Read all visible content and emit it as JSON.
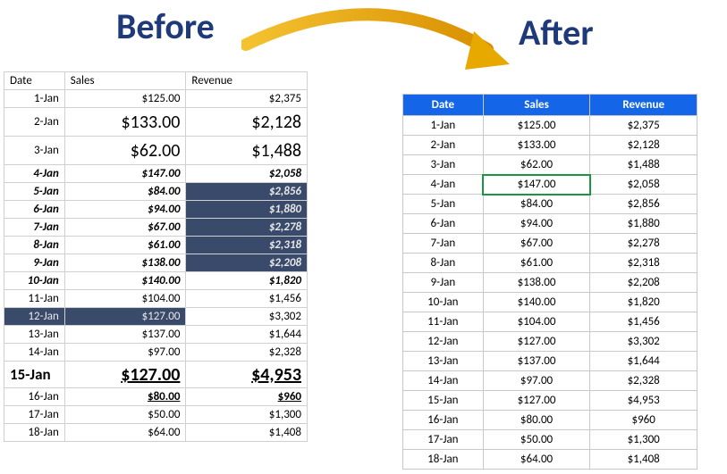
{
  "headings": {
    "before": "Before",
    "after": "After"
  },
  "columns": {
    "date": "Date",
    "sales": "Sales",
    "revenue": "Revenue"
  },
  "before_rows": [
    {
      "date": "1-Jan",
      "sales": "$125.00",
      "revenue": "$2,375"
    },
    {
      "date": "2-Jan",
      "sales": "$133.00",
      "revenue": "$2,128"
    },
    {
      "date": "3-Jan",
      "sales": "$62.00",
      "revenue": "$1,488"
    },
    {
      "date": "4-Jan",
      "sales": "$147.00",
      "revenue": "$2,058"
    },
    {
      "date": "5-Jan",
      "sales": "$84.00",
      "revenue": "$2,856"
    },
    {
      "date": "6-Jan",
      "sales": "$94.00",
      "revenue": "$1,880"
    },
    {
      "date": "7-Jan",
      "sales": "$67.00",
      "revenue": "$2,278"
    },
    {
      "date": "8-Jan",
      "sales": "$61.00",
      "revenue": "$2,318"
    },
    {
      "date": "9-Jan",
      "sales": "$138.00",
      "revenue": "$2,208"
    },
    {
      "date": "10-Jan",
      "sales": "$140.00",
      "revenue": "$1,820"
    },
    {
      "date": "11-Jan",
      "sales": "$104.00",
      "revenue": "$1,456"
    },
    {
      "date": "12-Jan",
      "sales": "$127.00",
      "revenue": "$3,302"
    },
    {
      "date": "13-Jan",
      "sales": "$137.00",
      "revenue": "$1,644"
    },
    {
      "date": "14-Jan",
      "sales": "$97.00",
      "revenue": "$2,328"
    },
    {
      "date": "15-Jan",
      "sales": "$127.00",
      "revenue": "$4,953"
    },
    {
      "date": "16-Jan",
      "sales": "$80.00",
      "revenue": "$960"
    },
    {
      "date": "17-Jan",
      "sales": "$50.00",
      "revenue": "$1,300"
    },
    {
      "date": "18-Jan",
      "sales": "$64.00",
      "revenue": "$1,408"
    }
  ],
  "after_rows": [
    {
      "date": "1-Jan",
      "sales": "$125.00",
      "revenue": "$2,375"
    },
    {
      "date": "2-Jan",
      "sales": "$133.00",
      "revenue": "$2,128"
    },
    {
      "date": "3-Jan",
      "sales": "$62.00",
      "revenue": "$1,488"
    },
    {
      "date": "4-Jan",
      "sales": "$147.00",
      "revenue": "$2,058"
    },
    {
      "date": "5-Jan",
      "sales": "$84.00",
      "revenue": "$2,856"
    },
    {
      "date": "6-Jan",
      "sales": "$94.00",
      "revenue": "$1,880"
    },
    {
      "date": "7-Jan",
      "sales": "$67.00",
      "revenue": "$2,278"
    },
    {
      "date": "8-Jan",
      "sales": "$61.00",
      "revenue": "$2,318"
    },
    {
      "date": "9-Jan",
      "sales": "$138.00",
      "revenue": "$2,208"
    },
    {
      "date": "10-Jan",
      "sales": "$140.00",
      "revenue": "$1,820"
    },
    {
      "date": "11-Jan",
      "sales": "$104.00",
      "revenue": "$1,456"
    },
    {
      "date": "12-Jan",
      "sales": "$127.00",
      "revenue": "$3,302"
    },
    {
      "date": "13-Jan",
      "sales": "$137.00",
      "revenue": "$1,644"
    },
    {
      "date": "14-Jan",
      "sales": "$97.00",
      "revenue": "$2,328"
    },
    {
      "date": "15-Jan",
      "sales": "$127.00",
      "revenue": "$4,953"
    },
    {
      "date": "16-Jan",
      "sales": "$80.00",
      "revenue": "$960"
    },
    {
      "date": "17-Jan",
      "sales": "$50.00",
      "revenue": "$1,300"
    },
    {
      "date": "18-Jan",
      "sales": "$64.00",
      "revenue": "$1,408"
    }
  ],
  "after_active_row_index": 3,
  "after_active_col": "sales",
  "colors": {
    "header_bg": "#1565E8",
    "heading_text": "#1F3A7A",
    "arrow": "#E7A800",
    "selection_bg": "#3A4A6B"
  }
}
